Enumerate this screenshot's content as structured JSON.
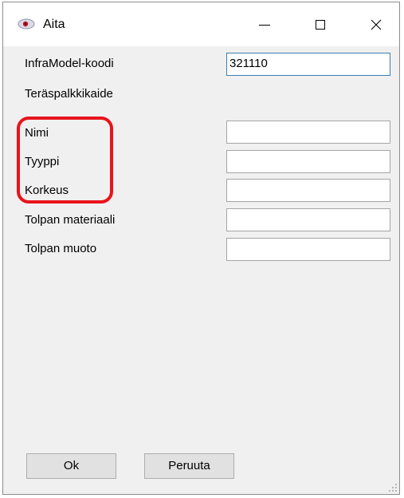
{
  "window": {
    "title": "Aita",
    "icon": "eye-icon",
    "controls": [
      "minimize-icon",
      "maximize-icon",
      "close-icon"
    ]
  },
  "form": {
    "infra_label": "InfraModel-koodi",
    "infra_value": "321110",
    "section_label": "Teräspalkkikaide",
    "fields": [
      {
        "label": "Nimi",
        "value": ""
      },
      {
        "label": "Tyyppi",
        "value": ""
      },
      {
        "label": "Korkeus",
        "value": ""
      },
      {
        "label": "Tolpan materiaali",
        "value": ""
      },
      {
        "label": "Tolpan muoto",
        "value": ""
      }
    ]
  },
  "buttons": {
    "ok": "Ok",
    "cancel": "Peruuta"
  },
  "colors": {
    "highlight": "#e8141c",
    "focus_border": "#3c7fb1",
    "window_bg": "#f0f0f0"
  }
}
